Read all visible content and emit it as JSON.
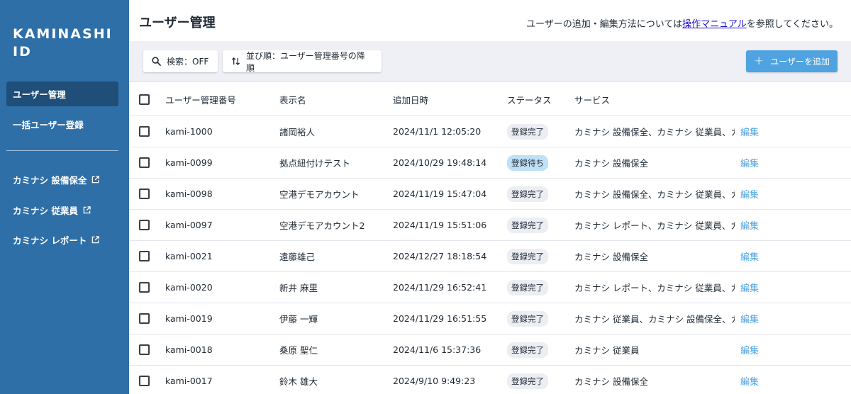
{
  "sidebar": {
    "logo_line1": "KAMINASHI",
    "logo_line2": "ID",
    "nav": [
      "ユーザー管理",
      "一括ユーザー登録"
    ],
    "external": [
      "カミナシ 設備保全",
      "カミナシ 従業員",
      "カミナシ レポート"
    ],
    "external_icon": "external-link-icon"
  },
  "header": {
    "title": "ユーザー管理",
    "help_prefix": "ユーザーの追加・編集方法については",
    "help_link": "操作マニュアル",
    "help_suffix": "を参照してください。"
  },
  "toolbar": {
    "search_label": "検索：OFF",
    "sort_label": "並び順：ユーザー管理番号の降順",
    "add_label": "ユーザーを追加"
  },
  "table": {
    "columns": [
      "ユーザー管理番号",
      "表示名",
      "追加日時",
      "ステータス",
      "サービス"
    ],
    "edit_label": "編集",
    "rows": [
      {
        "id": "kami-1000",
        "name": "諸岡裕人",
        "date": "2024/11/1 12:05:20",
        "status": "登録完了",
        "service": "カミナシ 設備保全、カミナシ 従業員、カミ"
      },
      {
        "id": "kami-0099",
        "name": "拠点紐付けテスト",
        "date": "2024/10/29 19:48:14",
        "status": "登録待ち",
        "service": "カミナシ 設備保全"
      },
      {
        "id": "kami-0098",
        "name": "空港デモアカウント",
        "date": "2024/11/19 15:47:04",
        "status": "登録完了",
        "service": "カミナシ 設備保全、カミナシ 従業員、カミ"
      },
      {
        "id": "kami-0097",
        "name": "空港デモアカウント2",
        "date": "2024/11/19 15:51:06",
        "status": "登録完了",
        "service": "カミナシ レポート、カミナシ 従業員、カミ"
      },
      {
        "id": "kami-0021",
        "name": "遠藤雄己",
        "date": "2024/12/27 18:18:54",
        "status": "登録完了",
        "service": "カミナシ 設備保全"
      },
      {
        "id": "kami-0020",
        "name": "新井 麻里",
        "date": "2024/11/29 16:52:41",
        "status": "登録完了",
        "service": "カミナシ レポート、カミナシ 従業員、カミ"
      },
      {
        "id": "kami-0019",
        "name": "伊藤 一輝",
        "date": "2024/11/29 16:51:55",
        "status": "登録完了",
        "service": "カミナシ 従業員、カミナシ 設備保全、カミ"
      },
      {
        "id": "kami-0018",
        "name": "桑原 聖仁",
        "date": "2024/11/6 15:37:36",
        "status": "登録完了",
        "service": "カミナシ 従業員"
      },
      {
        "id": "kami-0017",
        "name": "鈴木 雄大",
        "date": "2024/9/10 9:49:23",
        "status": "登録完了",
        "service": "カミナシ 設備保全"
      }
    ]
  },
  "colors": {
    "sidebar_bg": "#2f6fa8",
    "sidebar_active": "#1f4e78",
    "accent": "#4fa3e0",
    "badge_waiting": "#bfe0f7"
  }
}
